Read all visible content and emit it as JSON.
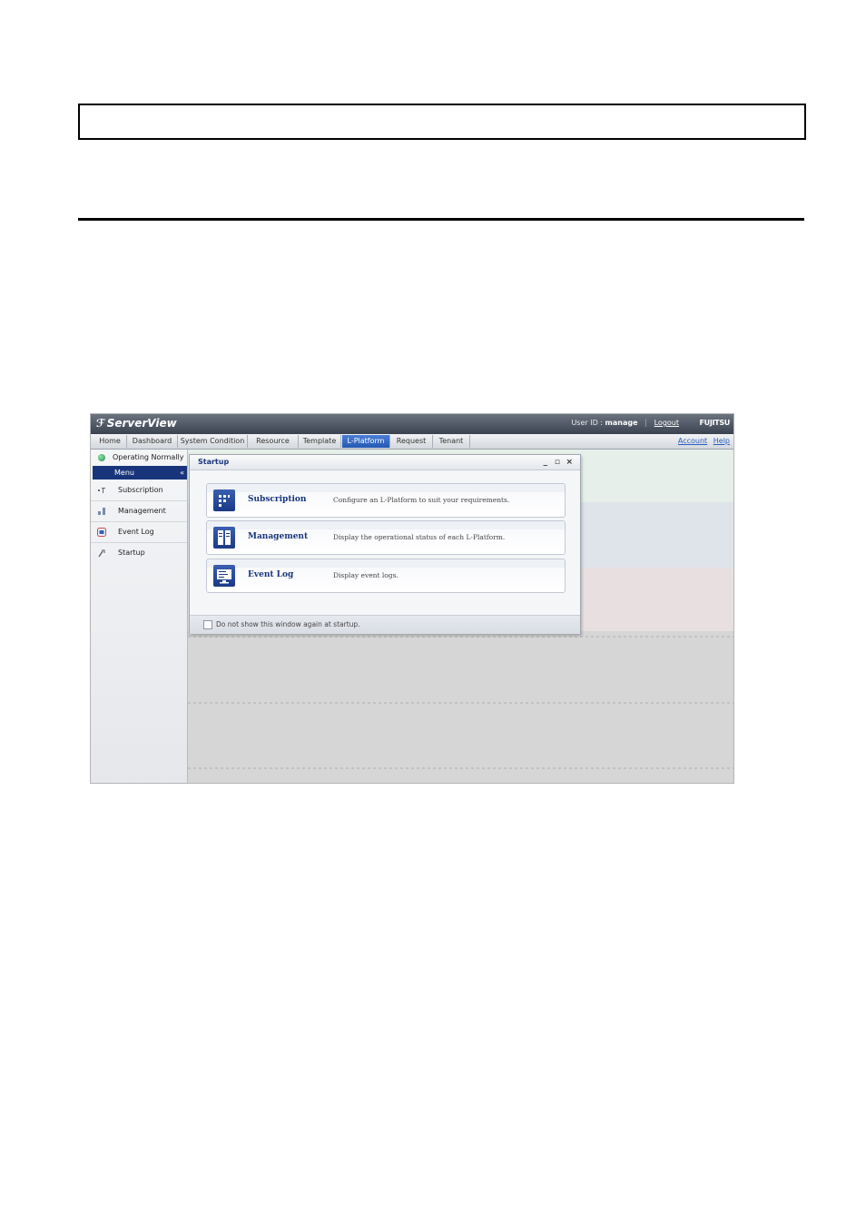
{
  "document": {
    "header_box_text": "",
    "section_title": ""
  },
  "app": {
    "brand": "ServerView",
    "user_label": "User ID :",
    "user_id": "manage",
    "logout": "Logout",
    "vendor_logo": "FUJITSU"
  },
  "tabs": [
    {
      "label": "Home",
      "active": false
    },
    {
      "label": "Dashboard",
      "active": false
    },
    {
      "label": "System Condition",
      "active": false
    },
    {
      "label": "Resource",
      "active": false
    },
    {
      "label": "Template",
      "active": false
    },
    {
      "label": "L-Platform",
      "active": true
    },
    {
      "label": "Request",
      "active": false
    },
    {
      "label": "Tenant",
      "active": false
    }
  ],
  "tab_links": {
    "account": "Account",
    "help": "Help"
  },
  "sidebar": {
    "status": "Operating Normally",
    "menu_header": "Menu",
    "collapse": "«",
    "items": [
      {
        "label": "Subscription",
        "icon": "subscription-icon"
      },
      {
        "label": "Management",
        "icon": "management-icon"
      },
      {
        "label": "Event Log",
        "icon": "event-log-icon"
      },
      {
        "label": "Startup",
        "icon": "startup-icon"
      }
    ]
  },
  "startup_window": {
    "title": "Startup",
    "controls": {
      "minimize": "_",
      "maximize": "▫",
      "close": "×"
    },
    "cards": [
      {
        "name": "Subscription",
        "desc": "Configure an L-Platform to suit your requirements."
      },
      {
        "name": "Management",
        "desc": "Display the operational status of each L-Platform."
      },
      {
        "name": "Event Log",
        "desc": "Display event logs."
      }
    ],
    "checkbox_label": "Do not show this window again at startup."
  },
  "colors": {
    "accent": "#18357c",
    "active_tab": "#2458b3",
    "status_ok": "#1f8f4a"
  }
}
